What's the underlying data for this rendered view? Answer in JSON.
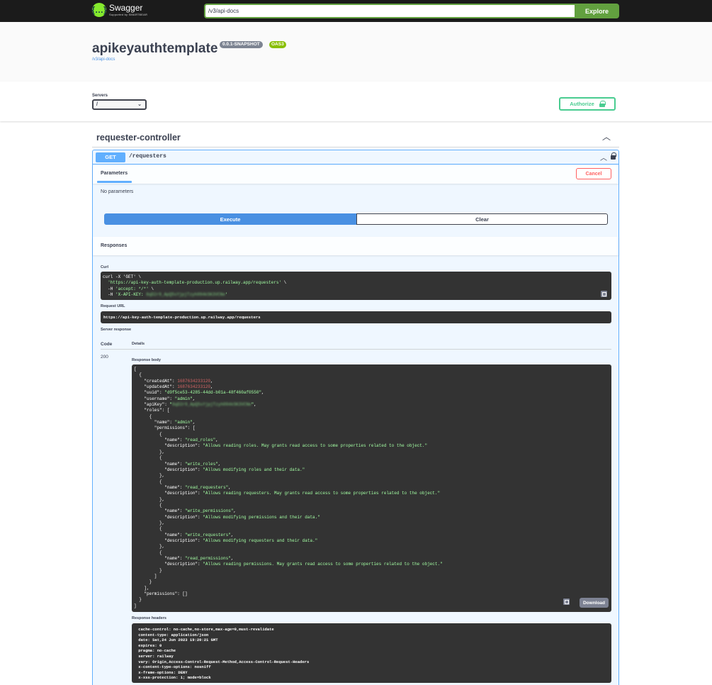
{
  "topbar": {
    "logo_text": "Swagger",
    "logo_sub": "Supported by SMARTBEAR",
    "url_value": "/v3/api-docs",
    "explore_label": "Explore"
  },
  "info": {
    "title": "apikeyauthtemplate",
    "version": "0.0.1-SNAPSHOT",
    "oas": "OAS3",
    "link": "/v3/api-docs"
  },
  "scheme": {
    "servers_label": "Servers",
    "server_selected": "/",
    "authorize_label": "Authorize"
  },
  "tag": {
    "name": "requester-controller"
  },
  "operation": {
    "method": "GET",
    "path": "/requesters",
    "parameters_tab": "Parameters",
    "cancel_label": "Cancel",
    "no_params": "No parameters",
    "execute_label": "Execute",
    "clear_label": "Clear",
    "responses_title": "Responses",
    "curl_label": "Curl",
    "request_url_label": "Request URL",
    "request_url": "https://api-key-auth-template-production.up.railway.app/requesters",
    "server_response_label": "Server response",
    "code_header": "Code",
    "details_header": "Details",
    "status_code": "200",
    "response_body_label": "Response body",
    "download_label": "Download",
    "response_headers_label": "Response headers",
    "curl_lines": {
      "l1": "curl -X 'GET' \\",
      "l2_url": "'https://api-key-auth-template-production.up.railway.app/requesters'",
      "l2_tail": " \\",
      "l3_pre": "  -H ",
      "l3_str": "'accept: */*'",
      "l3_tail": " \\",
      "l4_pre": "  -H ",
      "l4_str": "'X-API-KEY: ",
      "l4_blur": "8qD2r9_ApQ5sYjpjTzyh094kSK3VCNe",
      "l4_end": "'"
    },
    "response_body": {
      "created_at": "1687634233120",
      "updated_at": "1687634233120",
      "uuid": "\"d9f5ce53-4285-44dd-b01a-48f460af0550\"",
      "username": "\"admin\"",
      "api_key_blur": "8qD2r9_ApQ5sYjpjTzyh094kSK3VCNe",
      "role_name": "\"admin\"",
      "perm_read_roles": "\"read_roles\"",
      "desc_read_roles": "\"Allows reading roles. May grants read access to some properties related to the object.\"",
      "perm_write_roles": "\"write_roles\"",
      "desc_write_roles": "\"Allows modifying roles and their data.\"",
      "perm_read_requesters": "\"read_requesters\"",
      "desc_read_requesters": "\"Allows reading requesters. May grants read access to some properties related to the object.\"",
      "perm_write_permissions": "\"write_permissions\"",
      "desc_write_permissions": "\"Allows modifying permissions and their data.\"",
      "perm_write_requesters": "\"write_requesters\"",
      "desc_write_requesters": "\"Allows modifying requesters and their data.\"",
      "perm_read_permissions": "\"read_permissions\"",
      "desc_read_permissions": "\"Allows reading permissions. May grants read access to some properties related to the object.\""
    },
    "response_headers": {
      "cache_control": " cache-control: no-cache,no-store,max-age=0,must-revalidate ",
      "content_type": " content-type: application/json ",
      "date": " date: Sat,24 Jun 2023 19:20:21 GMT ",
      "expires": " expires: 0 ",
      "pragma": " pragma: no-cache ",
      "server": " server: railway ",
      "vary": " vary: Origin,Access-Control-Request-Method,Access-Control-Request-Headers ",
      "x_content_type_options": " x-content-type-options: nosniff ",
      "x_frame_options": " x-frame-options: DENY ",
      "x_xss_protection": " x-xss-protection: 1; mode=block "
    }
  },
  "colors": {
    "get": "#61affe",
    "green": "#49cc90",
    "cancel": "#ff6060",
    "execute": "#4990e2",
    "topbar": "#1b1b1b"
  }
}
